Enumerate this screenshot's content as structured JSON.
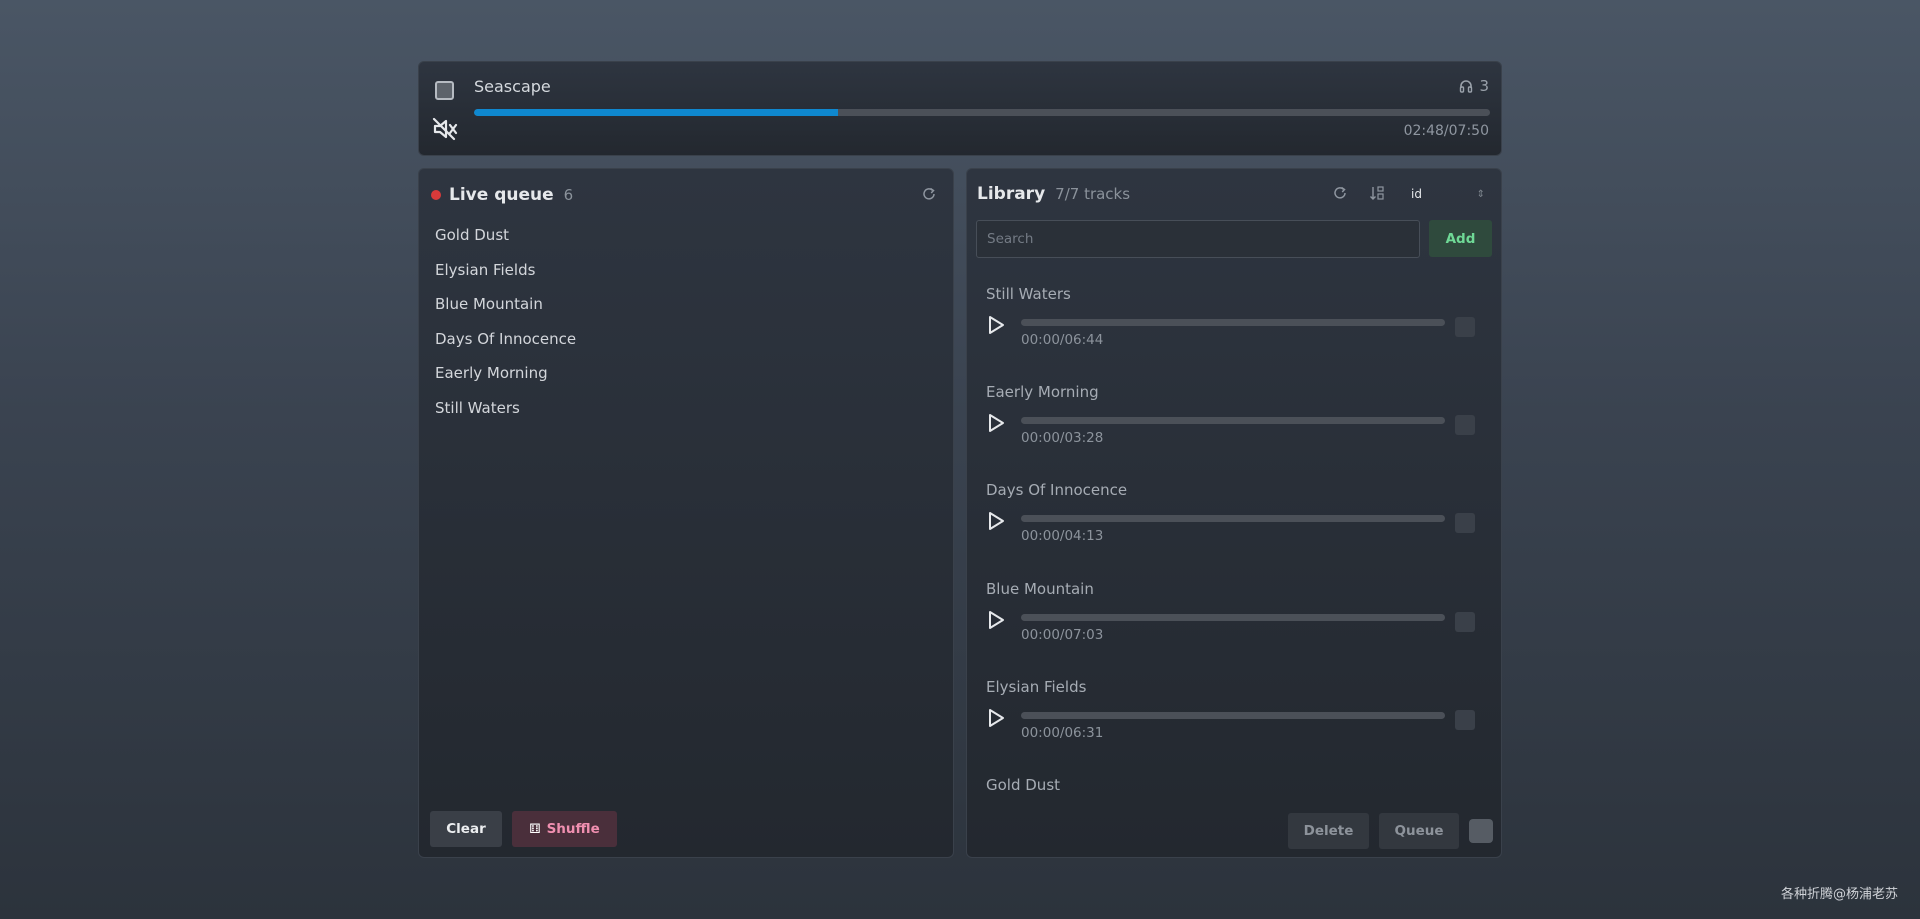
{
  "player": {
    "title": "Seascape",
    "listeners": "3",
    "progress_fraction": 0.3578,
    "time": "02:48/07:50",
    "accent_color": "#0f88cf",
    "icons": [
      "stop-icon",
      "mute-icon",
      "headphones-icon"
    ]
  },
  "queue": {
    "title": "Live queue",
    "count": "6",
    "live_color": "#d93a3a",
    "items": [
      "Gold Dust",
      "Elysian Fields",
      "Blue Mountain",
      "Days Of Innocence",
      "Eaerly Morning",
      "Still Waters"
    ],
    "clear_label": "Clear",
    "shuffle_label": "Shuffle"
  },
  "library": {
    "title": "Library",
    "count": "7/7 tracks",
    "sort_value": "id",
    "search_placeholder": "Search",
    "add_label": "Add",
    "tracks": [
      {
        "name": "Still Waters",
        "time": "00:00/06:44"
      },
      {
        "name": "Eaerly Morning",
        "time": "00:00/03:28"
      },
      {
        "name": "Days Of Innocence",
        "time": "00:00/04:13"
      },
      {
        "name": "Blue Mountain",
        "time": "00:00/07:03"
      },
      {
        "name": "Elysian Fields",
        "time": "00:00/06:31"
      },
      {
        "name": "Gold Dust",
        "time": ""
      }
    ],
    "delete_label": "Delete",
    "queue_label": "Queue"
  },
  "watermark": "各种折腾@杨浦老苏"
}
